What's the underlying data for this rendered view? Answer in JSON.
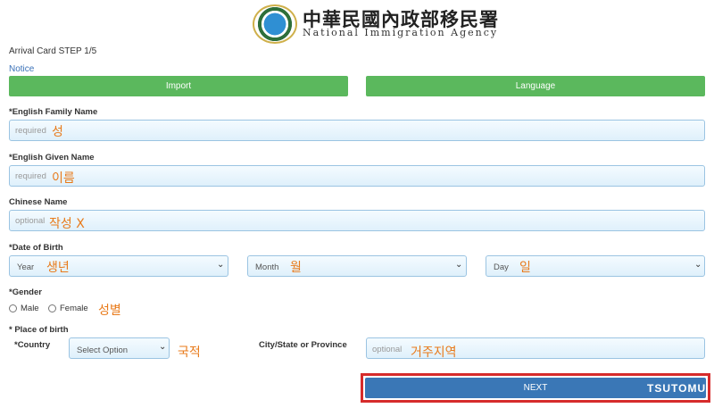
{
  "header": {
    "agency_name_zh": "中華民國內政部移民署",
    "agency_name_en": "National Immigration Agency"
  },
  "step_text": "Arrival Card STEP 1/5",
  "notice_link": "Notice",
  "buttons": {
    "import": "Import",
    "language": "Language",
    "next": "NEXT"
  },
  "fields": {
    "family_name": {
      "label": "*English Family Name",
      "placeholder": "required",
      "annotation": "성"
    },
    "given_name": {
      "label": "*English Given Name",
      "placeholder": "required",
      "annotation": "이름"
    },
    "chinese_name": {
      "label": "Chinese Name",
      "placeholder": "optional",
      "annotation": "작성 X"
    },
    "dob": {
      "label": "*Date of Birth",
      "year": {
        "text": "Year",
        "annotation": "생년"
      },
      "month": {
        "text": "Month",
        "annotation": "월"
      },
      "day": {
        "text": "Day",
        "annotation": "일"
      }
    },
    "gender": {
      "label": "*Gender",
      "male": "Male",
      "female": "Female",
      "annotation": "성별"
    },
    "place_of_birth": {
      "label": "* Place of birth",
      "country_label": "*Country",
      "country_selected": "Select Option",
      "country_annotation": "국적",
      "city_label": "City/State or Province",
      "city_placeholder": "optional",
      "city_annotation": "거주지역"
    }
  },
  "watermark": "TSUTOMU",
  "colors": {
    "green": "#5bb85d",
    "blue": "#3a77b6",
    "highlight": "#d62b2b",
    "annotation": "#e87a1a"
  }
}
